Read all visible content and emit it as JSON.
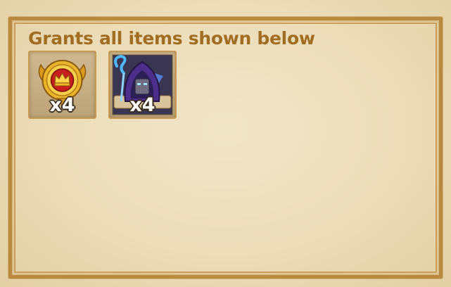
{
  "panel": {
    "title": "Grants all items shown below"
  },
  "items": [
    {
      "icon": "crown-medal-icon",
      "quantity": "x4"
    },
    {
      "icon": "hooded-wizard-hero-icon",
      "quantity": "x4"
    }
  ],
  "colors": {
    "title": "#a06d22",
    "frame": "#b8893f",
    "parchment": "#efe3c4"
  }
}
